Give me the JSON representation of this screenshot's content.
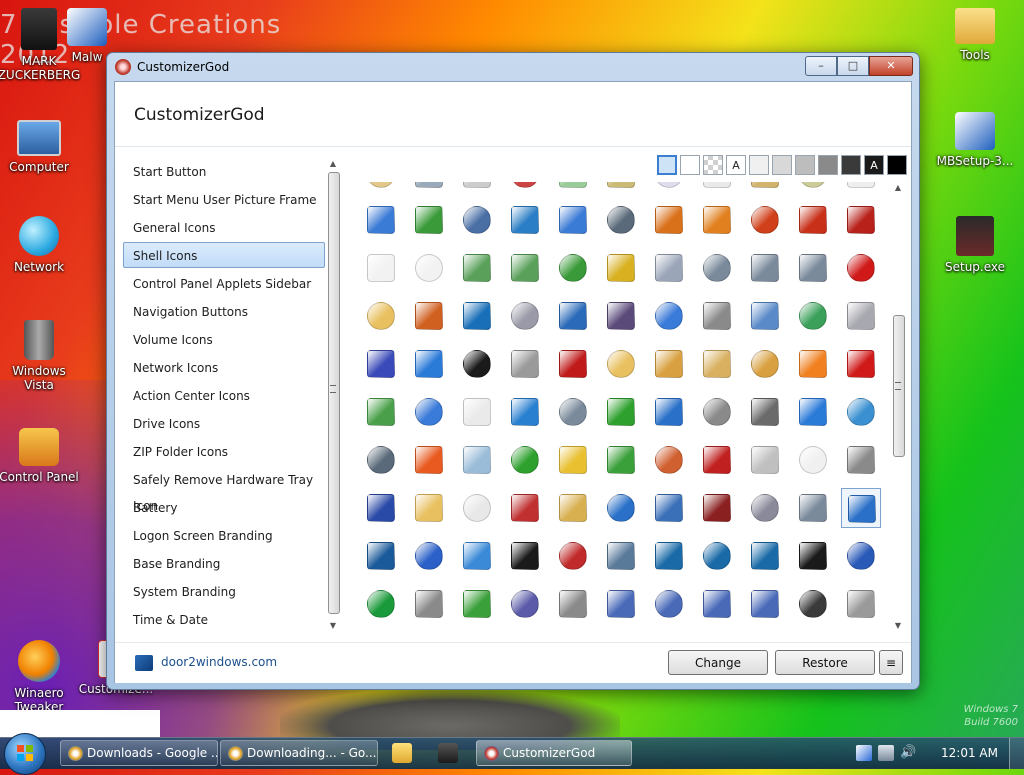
{
  "desktop": {
    "banner_text": "7 Possible Creations 2012",
    "watermark_line1": "Windows 7",
    "watermark_line2": "Build 7600",
    "icons": [
      {
        "label": "MARK ZUCKERBERG"
      },
      {
        "label": "Malw"
      },
      {
        "label": "Computer"
      },
      {
        "label": "Network"
      },
      {
        "label": "Windows Vista"
      },
      {
        "label": "Control Panel"
      },
      {
        "label": "Winaero Tweaker"
      },
      {
        "label": "Customize..."
      },
      {
        "label": "Tools"
      },
      {
        "label": "MBSetup-3..."
      },
      {
        "label": "Setup.exe"
      }
    ]
  },
  "window": {
    "title": "CustomizerGod",
    "app_title": "CustomizerGod",
    "buttons": {
      "minimize": "–",
      "maximize": "□",
      "close": "✕"
    },
    "categories": [
      "Start Button",
      "Start Menu User Picture Frame",
      "General Icons",
      "Shell Icons",
      "Control Panel Applets Sidebar",
      "Navigation Buttons",
      "Volume Icons",
      "Network Icons",
      "Action Center Icons",
      "Drive Icons",
      "ZIP Folder Icons",
      "Safely Remove Hardware Tray Icon",
      "Battery",
      "Logon Screen Branding",
      "Base Branding",
      "System Branding",
      "Time & Date"
    ],
    "selected_category": "Shell Icons",
    "swatches": [
      {
        "color": "#cfe3f6",
        "label": ""
      },
      {
        "color": "#ffffff",
        "label": ""
      },
      {
        "color": "checker",
        "label": ""
      },
      {
        "color": "#ffffff",
        "label": "A"
      },
      {
        "color": "#f0f0f0",
        "label": ""
      },
      {
        "color": "#d8d8d8",
        "label": ""
      },
      {
        "color": "#bdbdbd",
        "label": ""
      },
      {
        "color": "#8a8a8a",
        "label": ""
      },
      {
        "color": "#3a3a3a",
        "label": ""
      },
      {
        "color": "#1a1a1a",
        "label": "A"
      },
      {
        "color": "#000000",
        "label": ""
      }
    ],
    "icon_rows": [
      [
        "#e2c98a",
        "#9ab",
        "#ccc",
        "#c44",
        "#9c9",
        "#cb7",
        "#dde",
        "#e9e9e9",
        "#d2b36c",
        "#cc9",
        "#eee",
        "#ddd"
      ],
      [
        "#3a7bd5",
        "#3a9a3a",
        "#4a6fa5",
        "#2a7ec5",
        "#3a7bd5",
        "#5a6a7a",
        "#d9701a",
        "#e0801f",
        "#d0401a",
        "#c8301a",
        "#b8201a"
      ],
      [
        "#f2f2f2",
        "#f2f2f2",
        "#5aa05a",
        "#5aa05a",
        "#3a9a3a",
        "#d8b020",
        "#9aa6b8",
        "#7a8a9a",
        "#7a8a9a",
        "#7a8a9a",
        "#d01a1a"
      ],
      [
        "#e8c060",
        "#d06020",
        "#1a70b8",
        "#9a9aa8",
        "#2a6ab8",
        "#5a4a7a",
        "#3a7ad8",
        "#8a8a8a",
        "#5a8ac8",
        "#3aa05a",
        "#a8a8b0"
      ],
      [
        "#3a4ab8",
        "#2a7ad8",
        "#1a1a1a",
        "#9a9a9a",
        "#c01a1a",
        "#e8c060",
        "#d8a040",
        "#d8b060",
        "#d8a040",
        "#f08020",
        "#d01a1a"
      ],
      [
        "#4aa04a",
        "#3a7ad8",
        "#eaeaea",
        "#2a80d0",
        "#7a8a9a",
        "#2ea02e",
        "#2a70c8",
        "#8a8a8a",
        "#6a6a6a",
        "#2a7ad8",
        "#3a90d0"
      ],
      [
        "#5a6a7a",
        "#e85a20",
        "#9abcd8",
        "#2ea02e",
        "#e8c030",
        "#3aa03a",
        "#d06030",
        "#c02020",
        "#c0c0c0",
        "#f0f0f0",
        "#8a8a8a"
      ],
      [
        "#2a4aa8",
        "#e8c060",
        "#e8e8e8",
        "#c03030",
        "#d8b050",
        "#2a70c8",
        "#3a70b8",
        "#8a2020",
        "#8a8a9a",
        "#7a8a9a",
        "#2a70c8"
      ],
      [
        "#1a5a9a",
        "#2a60c8",
        "#3a8ad8",
        "#1a1a1a",
        "#c02a2a",
        "#5a7a9a",
        "#1a6aa8",
        "#1a6aa8",
        "#1a6aa8",
        "#1a1a1a",
        "#2a5ab8"
      ],
      [
        "#1a9a3a",
        "#8a8a8a",
        "#3aa03a",
        "#5a5aa8",
        "#8a8a8a",
        "#4a6ab8",
        "#4a6ab8",
        "#4a6ab8",
        "#4a6ab8",
        "#3a3a3a",
        "#9a9a9a"
      ]
    ],
    "footer": {
      "link": "door2windows.com",
      "change_label": "Change",
      "restore_label": "Restore",
      "menu_label": "≡"
    }
  },
  "taskbar": {
    "buttons": [
      {
        "label": "Downloads - Google ...",
        "color": "#e0a020"
      },
      {
        "label": "Downloading... - Go...",
        "color": "#e0a020"
      },
      {
        "label": "CustomizerGod",
        "color": "#c0392b"
      }
    ],
    "clock": "12:01 AM"
  }
}
